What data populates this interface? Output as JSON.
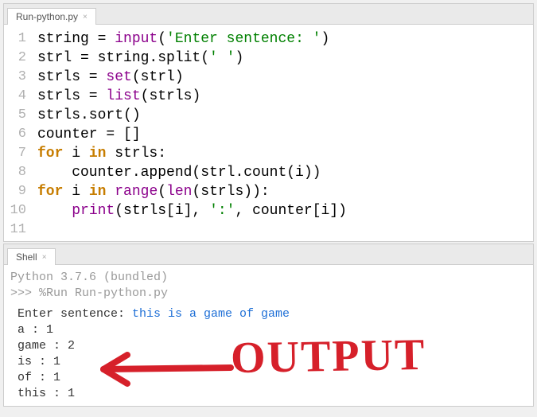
{
  "editor": {
    "tab_label": "Run-python.py",
    "lines": [
      {
        "n": "1"
      },
      {
        "n": "2"
      },
      {
        "n": "3"
      },
      {
        "n": "4"
      },
      {
        "n": "5"
      },
      {
        "n": "6"
      },
      {
        "n": "7"
      },
      {
        "n": "8"
      },
      {
        "n": "9"
      },
      {
        "n": "10"
      },
      {
        "n": "11"
      }
    ],
    "code": {
      "l1": {
        "a": "string = ",
        "b": "input",
        "c": "(",
        "d": "'Enter sentence: '",
        "e": ")"
      },
      "l2": {
        "a": "strl = string.split(",
        "b": "' '",
        "c": ")"
      },
      "l3": {
        "a": "strls = ",
        "b": "set",
        "c": "(strl)"
      },
      "l4": {
        "a": "strls = ",
        "b": "list",
        "c": "(strls)"
      },
      "l5": {
        "a": "strls.sort()"
      },
      "l6": {
        "a": "counter = []"
      },
      "l7": {
        "a": "for",
        "b": " i ",
        "c": "in",
        "d": " strls:"
      },
      "l8": {
        "a": "    counter.append(strl.count(i))"
      },
      "l9": {
        "a": "for",
        "b": " i ",
        "c": "in",
        "d": " ",
        "e": "range",
        "f": "(",
        "g": "len",
        "h": "(strls)):"
      },
      "l10": {
        "a": "    ",
        "b": "print",
        "c": "(strls[i], ",
        "d": "':'",
        "e": ", counter[i])"
      }
    }
  },
  "shell": {
    "tab_label": "Shell",
    "banner": "Python 3.7.6 (bundled)",
    "prompt": ">>> ",
    "run_cmd": "%Run Run-python.py",
    "input_label": " Enter sentence: ",
    "input_text": "this is a game of game",
    "out1": " a : 1",
    "out2": " game : 2",
    "out3": " is : 1",
    "out4": " of : 1",
    "out5": " this : 1"
  },
  "annotation": {
    "text": "OUTPUT"
  }
}
